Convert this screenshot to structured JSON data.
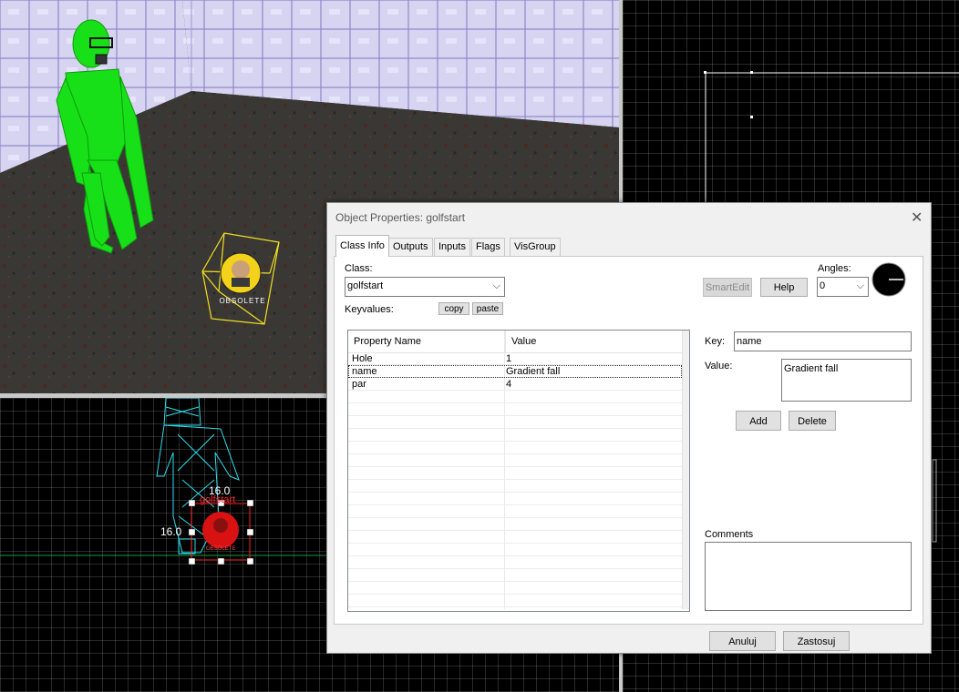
{
  "viewport_3d": {
    "entity_icon_label": "OBSOLETE"
  },
  "viewport_2d": {
    "width_label": "16.0",
    "height_label": "16.0",
    "entity_name_label": "golfstart",
    "icon_text": "OBSOLETE"
  },
  "dialog": {
    "title": "Object Properties: golfstart",
    "tabs": [
      "Class Info",
      "Outputs",
      "Inputs",
      "Flags",
      "VisGroup"
    ],
    "active_tab": "Class Info",
    "class_label": "Class:",
    "class_value": "golfstart",
    "keyvalues_label": "Keyvalues:",
    "copy_label": "copy",
    "paste_label": "paste",
    "smartedit_label": "SmartEdit",
    "help_label": "Help",
    "angles_label": "Angles:",
    "angles_value": "0",
    "columns": [
      "Property Name",
      "Value"
    ],
    "rows": [
      {
        "key": "Hole",
        "value": "1"
      },
      {
        "key": "name",
        "value": "Gradient fall"
      },
      {
        "key": "par",
        "value": "4"
      }
    ],
    "selected_row": 1,
    "key_label": "Key:",
    "key_value": "name",
    "value_label": "Value:",
    "value_value": "Gradient fall",
    "add_label": "Add",
    "delete_label": "Delete",
    "comments_label": "Comments",
    "comments_value": "",
    "cancel_label": "Anuluj",
    "apply_label": "Zastosuj"
  },
  "colors": {
    "selection_red": "#ff2020",
    "wireframe_cyan": "#28e0f0",
    "player_green": "#18e018",
    "bbox_yellow": "#f0e020"
  }
}
